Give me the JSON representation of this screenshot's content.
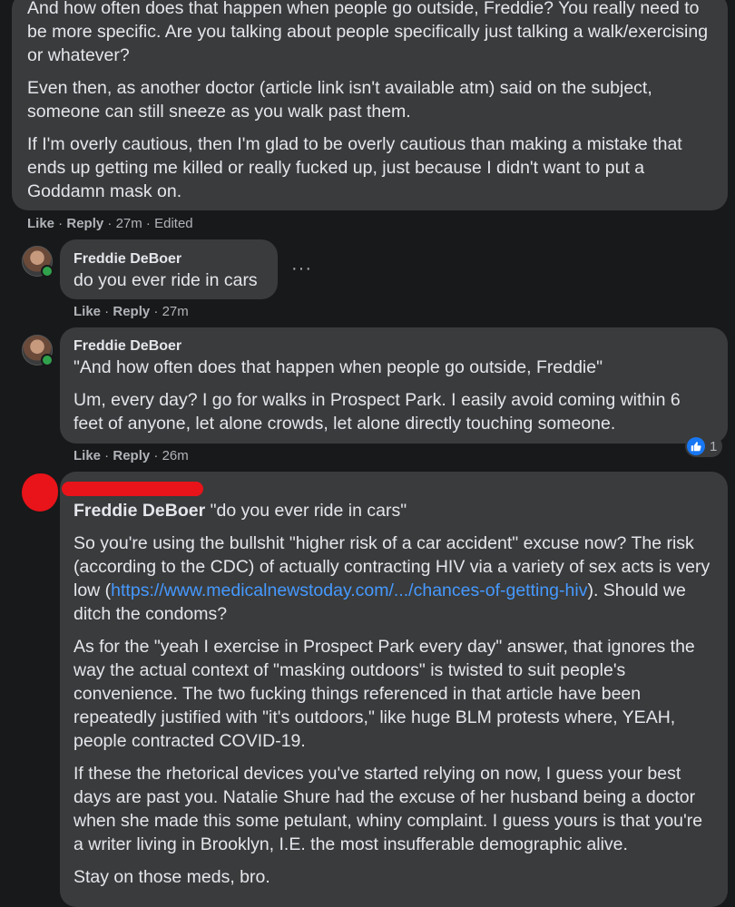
{
  "comments": [
    {
      "paragraphs": [
        "And how often does that happen when people go outside, Freddie? You really need to be more specific. Are you talking about people specifically just talking a walk/exercising or whatever?",
        "Even then, as another doctor (article link isn't available atm) said on the subject, someone can still sneeze as you walk past them.",
        "If I'm overly cautious, then I'm glad to be overly cautious than making a mistake that ends up getting me killed or really fucked up, just because I didn't want to put a Goddamn mask on."
      ],
      "like_label": "Like",
      "reply_label": "Reply",
      "time": "27m",
      "edited": "Edited"
    },
    {
      "author": "Freddie DeBoer",
      "text": "do you ever ride in cars",
      "like_label": "Like",
      "reply_label": "Reply",
      "time": "27m",
      "more": "···"
    },
    {
      "author": "Freddie DeBoer",
      "paragraphs": [
        "\"And how often does that happen when people go outside, Freddie\"",
        "Um, every day? I go for walks in Prospect Park. I easily avoid coming within 6 feet of anyone, let alone crowds, let alone directly touching someone."
      ],
      "like_label": "Like",
      "reply_label": "Reply",
      "time": "26m",
      "reaction_count": "1"
    },
    {
      "mention": "Freddie DeBoer",
      "quote": " \"do you ever ride in cars\"",
      "p1_before": "So you're using the bullshit \"higher risk of a car accident\" excuse now? The risk (according to the CDC) of actually contracting HIV via a variety of sex acts is very low (",
      "p1_link": "https://www.medicalnewstoday.com/.../chances-of-getting-hiv",
      "p1_after": "). Should we ditch the condoms?",
      "p2": "As for the \"yeah I exercise in Prospect Park every day\" answer, that ignores the way the actual context of \"masking outdoors\" is twisted to suit people's convenience. The two fucking things referenced in that article have been repeatedly justified with \"it's outdoors,\" like huge BLM protests where, YEAH, people contracted COVID-19.",
      "p3": "If these the rhetorical devices you've started relying on now, I guess your best days are past you. Natalie Shure had the excuse of her husband being a doctor when she made this some petulant, whiny complaint. I guess yours is that you're a writer living in Brooklyn, I.E. the most insufferable demographic alive.",
      "p4": "Stay on those meds, bro."
    }
  ],
  "colors": {
    "background": "#18191a",
    "bubble": "#3a3b3c",
    "text": "#e4e6eb",
    "meta": "#b0b3b8",
    "link": "#4599ff",
    "redaction": "#e8141a",
    "like_blue": "#1877f2",
    "online": "#31a24c"
  }
}
